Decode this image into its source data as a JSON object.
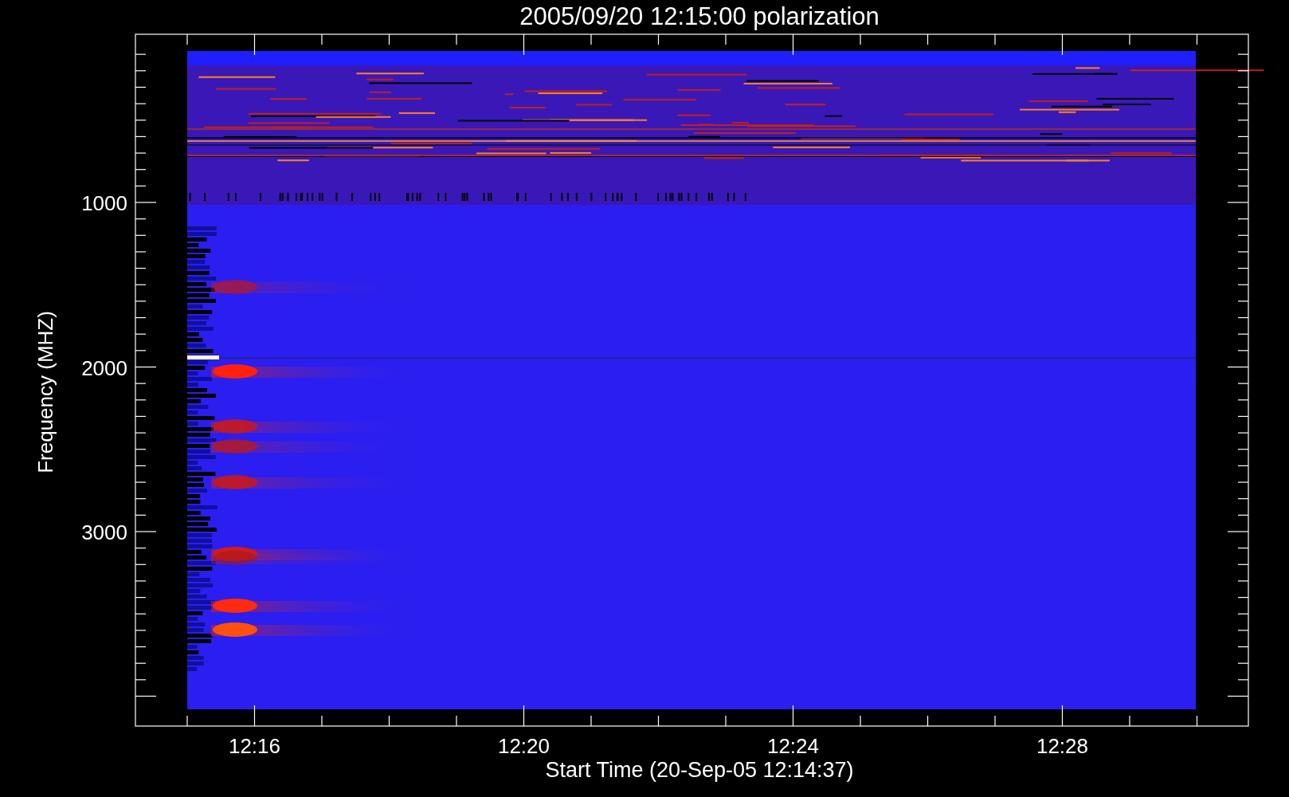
{
  "plot": {
    "title": "2005/09/20 12:15:00 polarization",
    "ylabel": "Frequency (MHZ)",
    "xlabel": "Start Time (20-Sep-05 12:14:37)",
    "yticks": [
      "1000",
      "2000",
      "3000"
    ],
    "xticks": [
      "12:16",
      "12:20",
      "12:24",
      "12:28"
    ]
  }
}
